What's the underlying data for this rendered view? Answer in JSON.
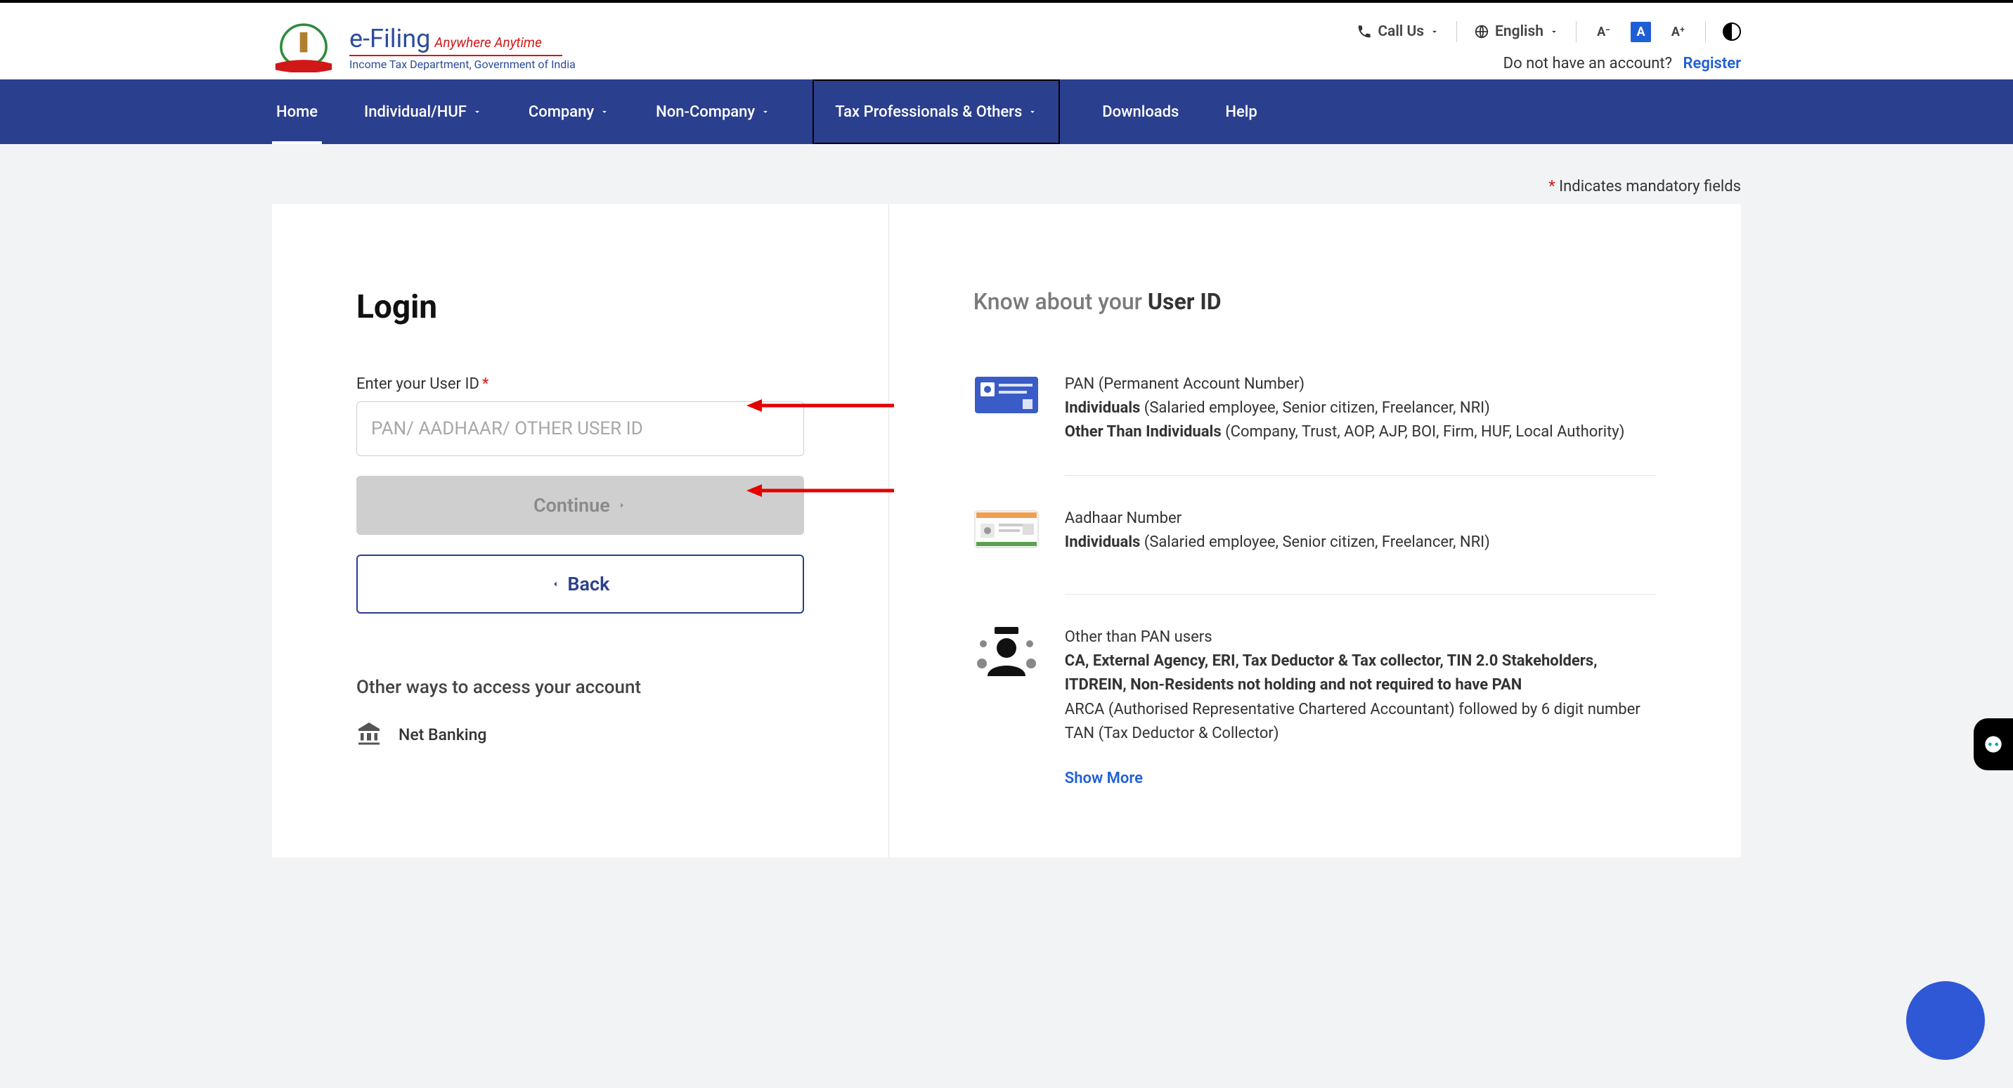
{
  "header": {
    "efiling": "e-Filing",
    "tagline": "Anywhere Anytime",
    "dept": "Income Tax Department, Government of India",
    "call_us": "Call Us",
    "language": "English",
    "font_minus": "A⁻",
    "font_normal": "A",
    "font_plus": "A⁺",
    "no_account": "Do not have an account?",
    "register": "Register"
  },
  "nav": {
    "home": "Home",
    "individual": "Individual/HUF",
    "company": "Company",
    "non_company": "Non-Company",
    "tax_prof": "Tax Professionals & Others",
    "downloads": "Downloads",
    "help": "Help"
  },
  "mandatory": "Indicates mandatory fields",
  "login": {
    "title": "Login",
    "user_id_label": "Enter your User ID",
    "user_id_placeholder": "PAN/ AADHAAR/ OTHER USER ID",
    "continue": "Continue",
    "back": "Back",
    "other_ways": "Other ways to access your account",
    "net_banking": "Net Banking"
  },
  "know": {
    "title_prefix": "Know about your ",
    "title_bold": "User ID",
    "pan": {
      "title": "PAN (Permanent Account Number)",
      "ind_b": "Individuals",
      "ind_t": " (Salaried employee, Senior citizen, Freelancer, NRI)",
      "oth_b": "Other Than Individuals",
      "oth_t": " (Company, Trust, AOP, AJP, BOI, Firm, HUF, Local Authority)"
    },
    "aadhaar": {
      "title": "Aadhaar Number",
      "ind_b": "Individuals",
      "ind_t": " (Salaried employee, Senior citizen, Freelancer, NRI)"
    },
    "other": {
      "title": "Other than PAN users",
      "bold": "CA, External Agency, ERI, Tax Deductor & Tax collector, TIN 2.0 Stakeholders, ITDREIN, Non-Residents not holding and not required to have PAN",
      "line2": "ARCA (Authorised Representative Chartered Accountant) followed by 6 digit number",
      "line3": "TAN (Tax Deductor & Collector)"
    },
    "show_more": "Show More"
  }
}
